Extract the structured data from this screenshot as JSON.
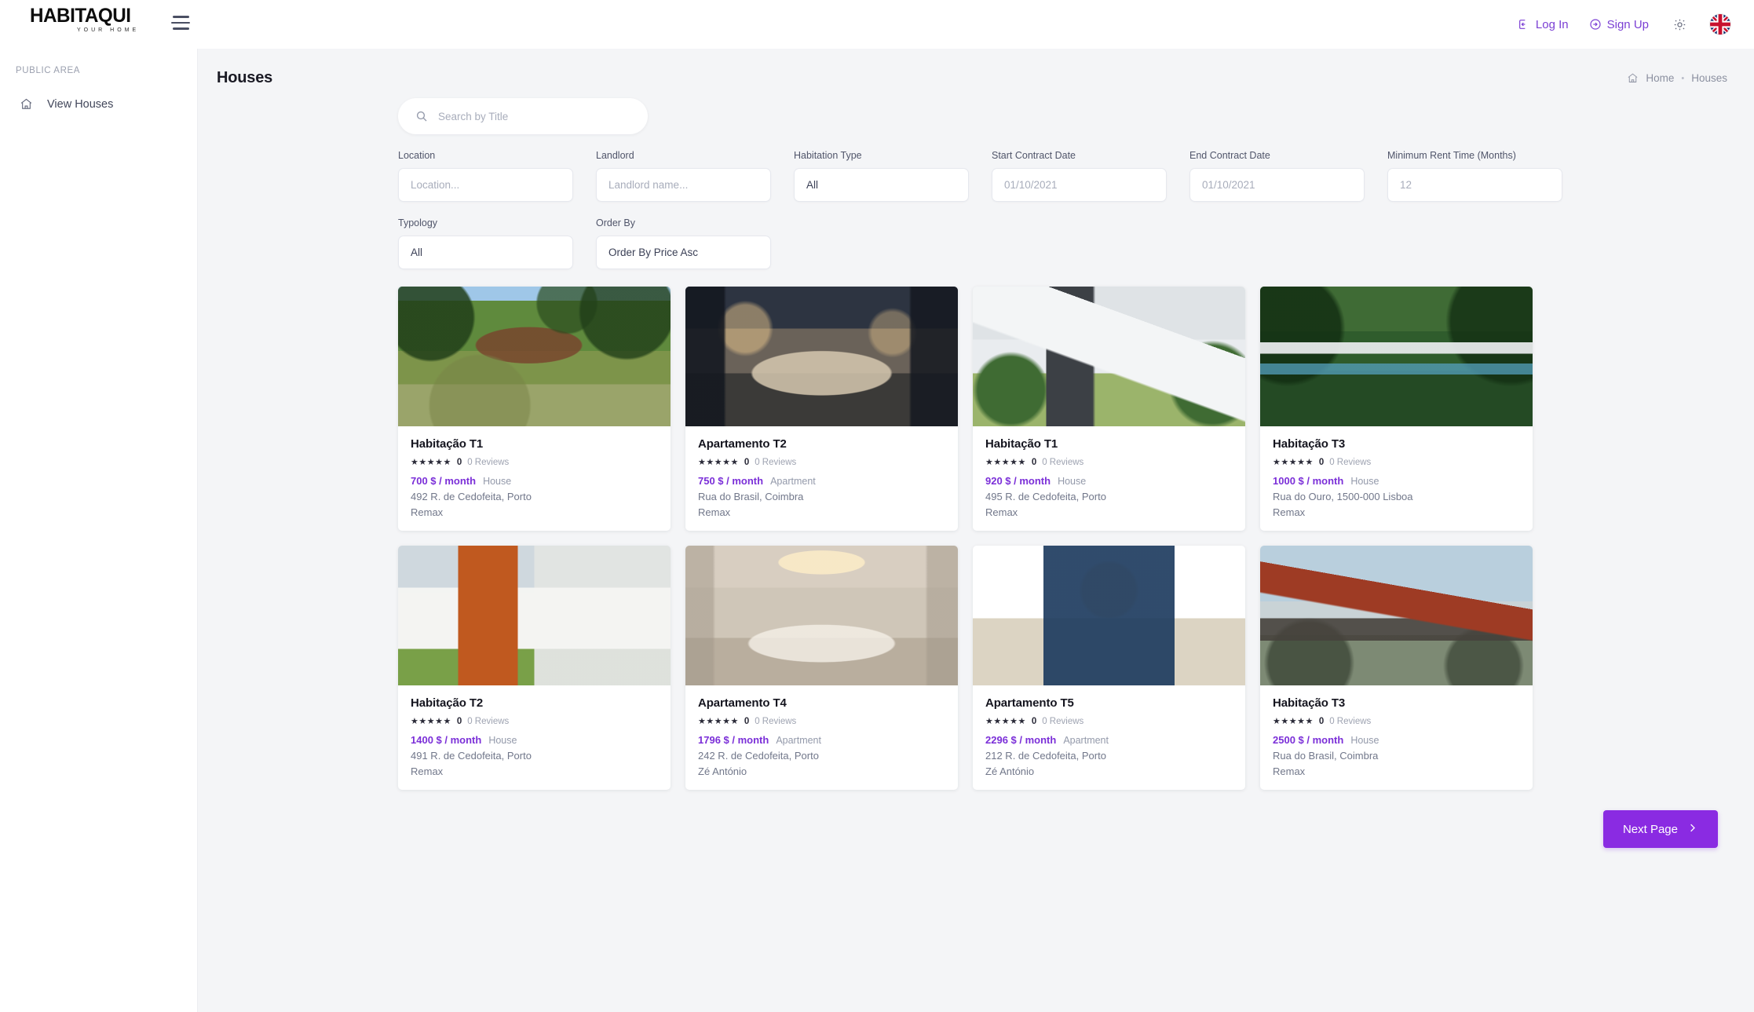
{
  "brand": {
    "name": "HABITAQUI",
    "tagline": "YOUR HOME"
  },
  "topbar": {
    "menu_icon": "hamburger-icon",
    "login_label": "Log In",
    "signup_label": "Sign Up",
    "theme_icon": "sun-icon",
    "language_icon": "uk-flag-icon"
  },
  "sidebar": {
    "section_title": "PUBLIC AREA",
    "items": [
      {
        "label": "View Houses",
        "icon": "home-icon"
      }
    ]
  },
  "page": {
    "title": "Houses",
    "breadcrumb": {
      "home": "Home",
      "separator": "•",
      "current": "Houses"
    }
  },
  "search": {
    "placeholder": "Search by Title",
    "value": "",
    "icon": "search-icon"
  },
  "filters": [
    {
      "label": "Location",
      "placeholder": "Location...",
      "value": "",
      "name": "location"
    },
    {
      "label": "Landlord",
      "placeholder": "Landlord name...",
      "value": "",
      "name": "landlord"
    },
    {
      "label": "Habitation Type",
      "placeholder": "",
      "value": "All",
      "name": "habitation-type"
    },
    {
      "label": "Start Contract Date",
      "placeholder": "01/10/2021",
      "value": "",
      "name": "start-contract-date"
    },
    {
      "label": "End Contract Date",
      "placeholder": "01/10/2021",
      "value": "",
      "name": "end-contract-date"
    },
    {
      "label": "Minimum Rent Time (Months)",
      "placeholder": "12",
      "value": "",
      "name": "minimum-rent-time"
    },
    {
      "label": "Typology",
      "placeholder": "",
      "value": "All",
      "name": "typology"
    },
    {
      "label": "Order By",
      "placeholder": "",
      "value": "Order By Price Asc",
      "name": "order-by"
    }
  ],
  "listings": [
    {
      "title": "Habitação T1",
      "stars": "★★★★★",
      "rating": "0",
      "reviews": "0 Reviews",
      "price": "700 $ / month",
      "type": "House",
      "address": "492 R. de Cedofeita, Porto",
      "landlord": "Remax",
      "photo": "ph-forest-cabin"
    },
    {
      "title": "Apartamento T2",
      "stars": "★★★★★",
      "rating": "0",
      "reviews": "0 Reviews",
      "price": "750 $ / month",
      "type": "Apartment",
      "address": "Rua do Brasil, Coimbra",
      "landlord": "Remax",
      "photo": "ph-lux-living"
    },
    {
      "title": "Habitação T1",
      "stars": "★★★★★",
      "rating": "0",
      "reviews": "0 Reviews",
      "price": "920 $ / month",
      "type": "House",
      "address": "495 R. de Cedofeita, Porto",
      "landlord": "Remax",
      "photo": "ph-modern-white"
    },
    {
      "title": "Habitação T3",
      "stars": "★★★★★",
      "rating": "0",
      "reviews": "0 Reviews",
      "price": "1000 $ / month",
      "type": "House",
      "address": "Rua do Ouro, 1500-000 Lisboa",
      "landlord": "Remax",
      "photo": "ph-jungle-villa"
    },
    {
      "title": "Habitação T2",
      "stars": "★★★★★",
      "rating": "0",
      "reviews": "0 Reviews",
      "price": "1400 $ / month",
      "type": "House",
      "address": "491 R. de Cedofeita, Porto",
      "landlord": "Remax",
      "photo": "ph-orange-house"
    },
    {
      "title": "Apartamento T4",
      "stars": "★★★★★",
      "rating": "0",
      "reviews": "0 Reviews",
      "price": "1796 $ / month",
      "type": "Apartment",
      "address": "242 R. de Cedofeita, Porto",
      "landlord": "Zé António",
      "photo": "ph-classic-living"
    },
    {
      "title": "Apartamento T5",
      "stars": "★★★★★",
      "rating": "0",
      "reviews": "0 Reviews",
      "price": "2296 $ / month",
      "type": "Apartment",
      "address": "212 R. de Cedofeita, Porto",
      "landlord": "Zé António",
      "photo": "ph-city-view"
    },
    {
      "title": "Habitação T3",
      "stars": "★★★★★",
      "rating": "0",
      "reviews": "0 Reviews",
      "price": "2500 $ / month",
      "type": "House",
      "address": "Rua do Brasil, Coimbra",
      "landlord": "Remax",
      "photo": "ph-red-modern"
    }
  ],
  "pagination": {
    "next_label": "Next Page",
    "next_icon": "chevron-right-icon"
  },
  "colors": {
    "accent": "#8a2be2",
    "price": "#7b2fd8",
    "link": "#7b3fd4",
    "page_bg": "#f4f5f7"
  }
}
